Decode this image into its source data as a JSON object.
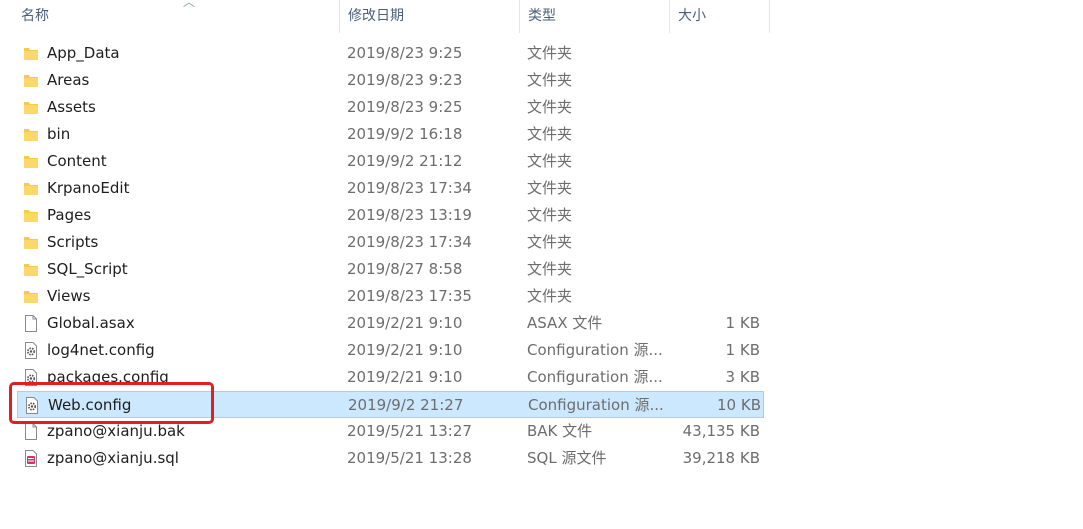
{
  "columns": {
    "name": "名称",
    "date": "修改日期",
    "type": "类型",
    "size": "大小"
  },
  "files": [
    {
      "name": "App_Data",
      "date": "2019/8/23 9:25",
      "type": "文件夹",
      "size": "",
      "icon": "folder-icon"
    },
    {
      "name": "Areas",
      "date": "2019/8/23 9:23",
      "type": "文件夹",
      "size": "",
      "icon": "folder-icon"
    },
    {
      "name": "Assets",
      "date": "2019/8/23 9:25",
      "type": "文件夹",
      "size": "",
      "icon": "folder-icon"
    },
    {
      "name": "bin",
      "date": "2019/9/2 16:18",
      "type": "文件夹",
      "size": "",
      "icon": "folder-icon"
    },
    {
      "name": "Content",
      "date": "2019/9/2 21:12",
      "type": "文件夹",
      "size": "",
      "icon": "folder-icon"
    },
    {
      "name": "KrpanoEdit",
      "date": "2019/8/23 17:34",
      "type": "文件夹",
      "size": "",
      "icon": "folder-icon"
    },
    {
      "name": "Pages",
      "date": "2019/8/23 13:19",
      "type": "文件夹",
      "size": "",
      "icon": "folder-icon"
    },
    {
      "name": "Scripts",
      "date": "2019/8/23 17:34",
      "type": "文件夹",
      "size": "",
      "icon": "folder-icon"
    },
    {
      "name": "SQL_Script",
      "date": "2019/8/27 8:58",
      "type": "文件夹",
      "size": "",
      "icon": "folder-icon"
    },
    {
      "name": "Views",
      "date": "2019/8/23 17:35",
      "type": "文件夹",
      "size": "",
      "icon": "folder-icon"
    },
    {
      "name": "Global.asax",
      "date": "2019/2/21 9:10",
      "type": "ASAX 文件",
      "size": "1 KB",
      "icon": "file-icon"
    },
    {
      "name": "log4net.config",
      "date": "2019/2/21 9:10",
      "type": "Configuration 源...",
      "size": "1 KB",
      "icon": "config-file-icon"
    },
    {
      "name": "packages.config",
      "date": "2019/2/21 9:10",
      "type": "Configuration 源...",
      "size": "3 KB",
      "icon": "config-file-icon"
    },
    {
      "name": "Web.config",
      "date": "2019/9/2 21:27",
      "type": "Configuration 源...",
      "size": "10 KB",
      "icon": "config-file-icon",
      "selected": true
    },
    {
      "name": "zpano@xianju.bak",
      "date": "2019/5/21 13:27",
      "type": "BAK 文件",
      "size": "43,135 KB",
      "icon": "file-icon"
    },
    {
      "name": "zpano@xianju.sql",
      "date": "2019/5/21 13:28",
      "type": "SQL 源文件",
      "size": "39,218 KB",
      "icon": "sql-file-icon"
    }
  ],
  "colors": {
    "selection": "#cce8ff",
    "selection_border": "#99d1ff",
    "annotation": "#e02020",
    "folder": "#f8c94a"
  }
}
